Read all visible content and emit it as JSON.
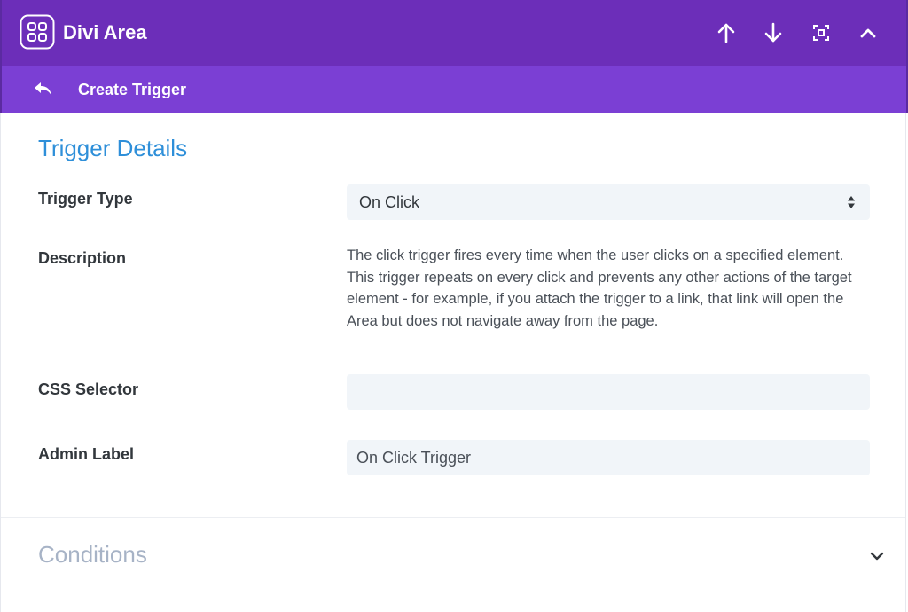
{
  "header": {
    "title": "Divi Area",
    "icons": {
      "logo": "grid-logo-icon",
      "move_up": "arrow-up-icon",
      "move_down": "arrow-down-icon",
      "fullscreen": "expand-icon",
      "collapse": "chevron-up-icon"
    }
  },
  "subheader": {
    "title": "Create Trigger",
    "back_icon": "back-arrow-icon"
  },
  "trigger_details": {
    "section_title": "Trigger Details",
    "trigger_type": {
      "label": "Trigger Type",
      "value": "On Click"
    },
    "description": {
      "label": "Description",
      "text": "The click trigger fires every time when the user clicks on a specified element. This trigger repeats on every click and prevents any other actions of the target element - for example, if you attach the trigger to a link, that link will open the Area but does not navigate away from the page."
    },
    "css_selector": {
      "label": "CSS Selector",
      "value": "",
      "placeholder": ""
    },
    "admin_label": {
      "label": "Admin Label",
      "value": "On Click Trigger"
    }
  },
  "conditions": {
    "title": "Conditions",
    "toggle_icon": "chevron-down-icon"
  },
  "colors": {
    "header_bg": "#6c2eb9",
    "subheader_bg": "#7b3fd4",
    "section_title": "#2e8fd9",
    "input_bg": "#f1f5f9",
    "conditions_title": "#a7b3c6"
  }
}
